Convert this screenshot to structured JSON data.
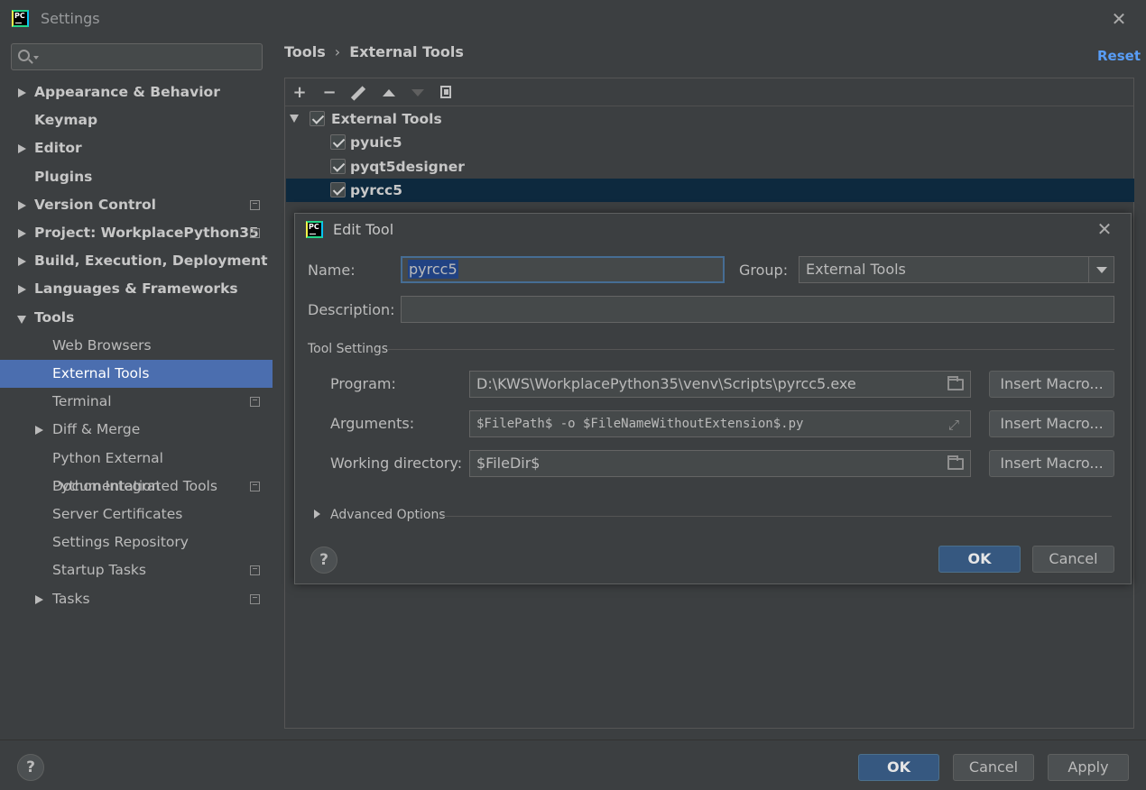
{
  "window": {
    "title": "Settings"
  },
  "sidebar": {
    "search": {
      "placeholder": ""
    },
    "items": [
      {
        "label": "Appearance & Behavior",
        "expandable": true,
        "expanded": false,
        "level": 0,
        "bold": true,
        "project_icon": false
      },
      {
        "label": "Keymap",
        "expandable": false,
        "level": 0,
        "bold": true,
        "project_icon": false
      },
      {
        "label": "Editor",
        "expandable": true,
        "expanded": false,
        "level": 0,
        "bold": true,
        "project_icon": false
      },
      {
        "label": "Plugins",
        "expandable": false,
        "level": 0,
        "bold": true,
        "project_icon": false
      },
      {
        "label": "Version Control",
        "expandable": true,
        "expanded": false,
        "level": 0,
        "bold": true,
        "project_icon": true
      },
      {
        "label": "Project: WorkplacePython35",
        "expandable": true,
        "expanded": false,
        "level": 0,
        "bold": true,
        "project_icon": true
      },
      {
        "label": "Build, Execution, Deployment",
        "expandable": true,
        "expanded": false,
        "level": 0,
        "bold": true,
        "project_icon": false
      },
      {
        "label": "Languages & Frameworks",
        "expandable": true,
        "expanded": false,
        "level": 0,
        "bold": true,
        "project_icon": false
      },
      {
        "label": "Tools",
        "expandable": true,
        "expanded": true,
        "level": 0,
        "bold": true,
        "project_icon": false
      },
      {
        "label": "Web Browsers",
        "expandable": false,
        "level": 1,
        "bold": false,
        "project_icon": false
      },
      {
        "label": "External Tools",
        "expandable": false,
        "level": 1,
        "bold": false,
        "selected": true,
        "project_icon": false
      },
      {
        "label": "Terminal",
        "expandable": false,
        "level": 1,
        "bold": false,
        "project_icon": true
      },
      {
        "label": "Diff & Merge",
        "expandable": true,
        "expanded": false,
        "level": 1,
        "bold": false,
        "project_icon": false
      },
      {
        "label": "Python External Documentation",
        "expandable": false,
        "level": 1,
        "bold": false,
        "project_icon": false
      },
      {
        "label": "Python Integrated Tools",
        "expandable": false,
        "level": 1,
        "bold": false,
        "project_icon": true
      },
      {
        "label": "Server Certificates",
        "expandable": false,
        "level": 1,
        "bold": false,
        "project_icon": false
      },
      {
        "label": "Settings Repository",
        "expandable": false,
        "level": 1,
        "bold": false,
        "project_icon": false
      },
      {
        "label": "Startup Tasks",
        "expandable": false,
        "level": 1,
        "bold": false,
        "project_icon": true
      },
      {
        "label": "Tasks",
        "expandable": true,
        "expanded": false,
        "level": 1,
        "bold": false,
        "project_icon": true
      }
    ]
  },
  "breadcrumb": {
    "parent": "Tools",
    "separator": "›",
    "current": "External Tools"
  },
  "reset_label": "Reset",
  "toolbar": {
    "icons": [
      "add-icon",
      "remove-icon",
      "edit-icon",
      "move-up-icon",
      "move-down-icon",
      "copy-icon"
    ],
    "move_down_enabled": false
  },
  "tool_tree": {
    "group": {
      "label": "External Tools",
      "checked": true,
      "expanded": true
    },
    "tools": [
      {
        "label": "pyuic5",
        "checked": true,
        "selected": false
      },
      {
        "label": "pyqt5designer",
        "checked": true,
        "selected": false
      },
      {
        "label": "pyrcc5",
        "checked": true,
        "selected": true
      }
    ]
  },
  "edit_tool": {
    "title": "Edit Tool",
    "name_label": "Name:",
    "name_value": "pyrcc5",
    "group_label": "Group:",
    "group_value": "External Tools",
    "description_label": "Description:",
    "description_value": "",
    "tool_settings_title": "Tool Settings",
    "program_label": "Program:",
    "program_value": "D:\\KWS\\WorkplacePython35\\venv\\Scripts\\pyrcc5.exe",
    "arguments_label": "Arguments:",
    "arguments_value": "$FilePath$ -o $FileNameWithoutExtension$.py",
    "workdir_label": "Working directory:",
    "workdir_value": "$FileDir$",
    "insert_macro_label": "Insert Macro...",
    "advanced_label": "Advanced Options",
    "ok_label": "OK",
    "cancel_label": "Cancel",
    "help_label": "?"
  },
  "footer": {
    "help_label": "?",
    "ok_label": "OK",
    "cancel_label": "Cancel",
    "apply_label": "Apply"
  },
  "colors": {
    "accent": "#4b6eaf",
    "link": "#589df6",
    "background": "#3c3f41",
    "default_button": "#365880",
    "tree_selection": "#0d293e"
  }
}
